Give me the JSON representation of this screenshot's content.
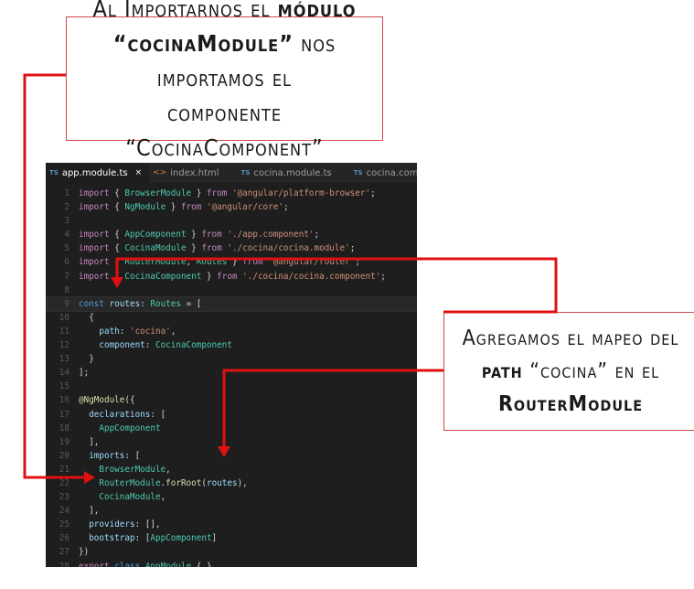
{
  "callouts": {
    "top": {
      "line1_a": "Al Importarnos el ",
      "line1_b": "módulo",
      "line2_a": "“cocinaModule”",
      "line2_b": " nos importamos el",
      "line3": "componente “CocinaComponent”"
    },
    "right": {
      "line1": "Agregamos el mapeo del",
      "line2_a": "path",
      "line2_b": " “cocina” en el",
      "line3": "RouterModule"
    }
  },
  "tabs": [
    {
      "icon": "TS",
      "label": "app.module.ts",
      "active": true,
      "close": "×"
    },
    {
      "icon": "<>",
      "label": "index.html",
      "active": false
    },
    {
      "icon": "TS",
      "label": "cocina.module.ts",
      "active": false
    },
    {
      "icon": "TS",
      "label": "cocina.component.t",
      "active": false
    }
  ],
  "code_lines": [
    "import { BrowserModule } from '@angular/platform-browser';",
    "import { NgModule } from '@angular/core';",
    "",
    "import { AppComponent } from './app.component';",
    "import { CocinaModule } from './cocina/cocina.module';",
    "import { RouterModule, Routes } from '@angular/router';",
    "import { CocinaComponent } from './cocina/cocina.component';",
    "",
    "const routes: Routes = [",
    "  {",
    "    path: 'cocina',",
    "    component: CocinaComponent",
    "  }",
    "];",
    "",
    "@NgModule({",
    "  declarations: [",
    "    AppComponent",
    "  ],",
    "  imports: [",
    "    BrowserModule,",
    "    RouterModule.forRoot(routes),",
    "    CocinaModule,",
    "  ],",
    "  providers: [],",
    "  bootstrap: [AppComponent]",
    "})",
    "export class AppModule { }",
    ""
  ],
  "colors": {
    "arrow": "#e01010",
    "callout_border": "#d04848",
    "editor_bg": "#1e1e1e"
  }
}
